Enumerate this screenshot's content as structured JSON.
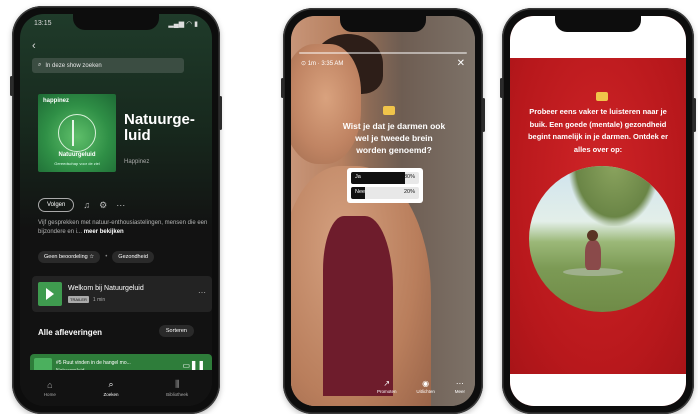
{
  "phone1": {
    "status_time": "13:15",
    "status_icons": "▂▄▆ ◠ ▮",
    "search_placeholder": "In deze show zoeken",
    "cover_brand": "happinez",
    "cover_title": "Natuurgeluid",
    "cover_subtitle": "Gereedschap voor de ziel",
    "show_title": "Natuurge-luid",
    "publisher": "Happinez",
    "follow_label": "Volgen",
    "description": "Vijf gesprekken met natuur-enthousiastelingen, mensen die een bijzondere en i...",
    "description_more": "meer bekijken",
    "chips": [
      "Geen beoordeling ☆",
      "Gezondheid"
    ],
    "episode": {
      "title": "Welkom bij Natuurgeluid",
      "badge": "TRAILER",
      "duration": "1 min"
    },
    "section_title": "Alle afleveringen",
    "sort_label": "Sorteren",
    "now_playing": {
      "title": "#5 Ruut vinden in de hangel mo...",
      "subtitle": "Natuurgeluid"
    },
    "nav": [
      {
        "icon": "⌂",
        "label": "Home"
      },
      {
        "icon": "⌕",
        "label": "Zoeken"
      },
      {
        "icon": "⫼",
        "label": "Bibliotheek"
      }
    ]
  },
  "phone2": {
    "story_time": "⊙ 1m  ·  3:35 AM",
    "question": "Wist je dat je darmen ook wel je tweede brein worden genoemd?",
    "poll": [
      {
        "label": "Ja",
        "pct": "80%",
        "value": 0.8
      },
      {
        "label": "Nee",
        "pct": "20%",
        "value": 0.2
      }
    ],
    "actions": [
      {
        "icon": "↗",
        "label": "Promoten"
      },
      {
        "icon": "◉",
        "label": "Uitlichten"
      },
      {
        "icon": "⋯",
        "label": "Meer"
      }
    ]
  },
  "phone3": {
    "text": "Probeer eens vaker te luisteren naar je buik. Een goede (mentale) gezondheid begint namelijk in je darmen. Ontdek er alles over op:"
  },
  "colors": {
    "spotify_green": "#2e7d3a",
    "story_red": "#c01c1f",
    "poll_fill": "#111111"
  }
}
